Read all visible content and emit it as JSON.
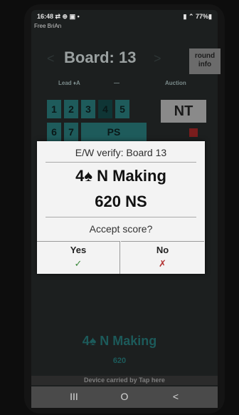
{
  "status": {
    "time_icons": "16:48 ⇄ ⊕ ▣ •",
    "right": "▮ ⌃ 77%▮"
  },
  "app": {
    "name": "Free BriAn"
  },
  "header": {
    "board_title": "Board: 13",
    "prev": "<",
    "next": ">",
    "round_info_line1": "round",
    "round_info_line2": "info"
  },
  "labels": {
    "lead": "Lead ♦A",
    "dash": "—",
    "auction": "Auction"
  },
  "levels": [
    "1",
    "2",
    "3",
    "4",
    "5"
  ],
  "row2": {
    "n6": "6",
    "n7": "7",
    "pass": "PS"
  },
  "strain": "NT",
  "dialog": {
    "title": "E/W verify: Board 13",
    "contract": "4♠  N  Making",
    "score": "620 NS",
    "question": "Accept score?",
    "yes_label": "Yes",
    "yes_icon": "✓",
    "no_label": "No",
    "no_icon": "✗"
  },
  "background_result": {
    "contract": "4♠  N  Making",
    "score": "620"
  },
  "device_bar": "Device carried by Tap here",
  "navbar": {
    "recent": "III",
    "home": "O",
    "back": "<"
  }
}
